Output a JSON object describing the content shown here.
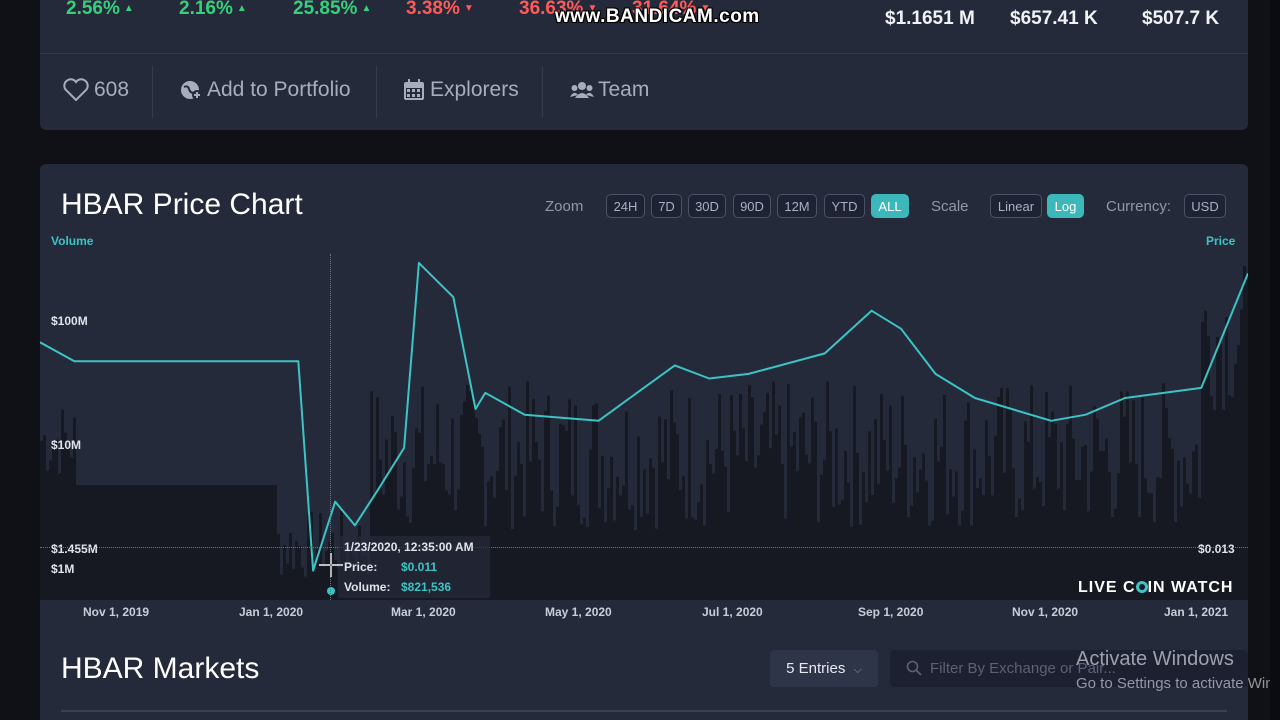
{
  "top_stats": {
    "changes": [
      {
        "value": "2.56%",
        "direction": "up"
      },
      {
        "value": "2.16%",
        "direction": "up"
      },
      {
        "value": "25.85%",
        "direction": "up"
      },
      {
        "value": "3.38%",
        "direction": "down"
      },
      {
        "value": "36.63%",
        "direction": "down"
      },
      {
        "value": "31.64%",
        "direction": "down"
      }
    ],
    "values": [
      "$1.1651 M",
      "$657.41 K",
      "$507.7 K"
    ]
  },
  "watermark": "www.BANDICAM.com",
  "actions": {
    "likes": "608",
    "portfolio": "Add to Portfolio",
    "explorers": "Explorers",
    "team": "Team"
  },
  "chart": {
    "title": "HBAR Price Chart",
    "zoom_label": "Zoom",
    "zoom_options": [
      "24H",
      "7D",
      "30D",
      "90D",
      "12M",
      "YTD",
      "ALL"
    ],
    "zoom_active": "ALL",
    "scale_label": "Scale",
    "scale_options": [
      "Linear",
      "Log"
    ],
    "scale_active": "Log",
    "currency_label": "Currency:",
    "currency": "USD",
    "volume_label": "Volume",
    "price_label": "Price",
    "ylabels": [
      "$100M",
      "$10M",
      "$1.455M",
      "$1M"
    ],
    "current_price": "$0.013",
    "xlabels": [
      "Nov 1, 2019",
      "Jan 1, 2020",
      "Mar 1, 2020",
      "May 1, 2020",
      "Jul 1, 2020",
      "Sep 1, 2020",
      "Nov 1, 2020",
      "Jan 1, 2021"
    ],
    "tooltip": {
      "date": "1/23/2020, 12:35:00 AM",
      "price_label": "Price:",
      "price": "$0.011",
      "volume_label": "Volume:",
      "volume": "$821,536"
    },
    "brand": "LIVE COIN WATCH",
    "colors": {
      "line": "#3cc4c4",
      "bars": "#151821",
      "accent": "#3cb8ba"
    }
  },
  "chart_data": {
    "type": "line",
    "title": "HBAR Price Chart",
    "x": [
      "2019-09-17",
      "2019-10-01",
      "2019-11-01",
      "2019-12-01",
      "2019-12-31",
      "2020-01-06",
      "2020-01-15",
      "2020-01-23",
      "2020-02-01",
      "2020-02-12",
      "2020-02-18",
      "2020-03-03",
      "2020-03-12",
      "2020-03-16",
      "2020-04-01",
      "2020-05-01",
      "2020-06-01",
      "2020-06-15",
      "2020-07-01",
      "2020-08-01",
      "2020-08-20",
      "2020-09-01",
      "2020-09-15",
      "2020-10-01",
      "2020-11-01",
      "2020-11-15",
      "2020-12-01",
      "2021-01-01",
      "2021-01-20"
    ],
    "series": [
      {
        "values": [
          0.04,
          0.035,
          0.035,
          0.035,
          0.035,
          0.008,
          0.013,
          0.011,
          0.014,
          0.019,
          0.07,
          0.055,
          0.025,
          0.028,
          0.024,
          0.023,
          0.034,
          0.031,
          0.032,
          0.037,
          0.05,
          0.044,
          0.032,
          0.027,
          0.023,
          0.024,
          0.027,
          0.029,
          0.065
        ]
      }
    ],
    "volume_range": [
      "$1M",
      "$100M"
    ],
    "yscale": "log",
    "ylim_volume": [
      1000000,
      300000000
    ]
  },
  "markets": {
    "title": "HBAR Markets",
    "entries": "5 Entries",
    "filter_placeholder": "Filter By Exchange or Pair..."
  },
  "os_overlay": {
    "title": "Activate Windows",
    "subtitle": "Go to Settings to activate Windows."
  }
}
